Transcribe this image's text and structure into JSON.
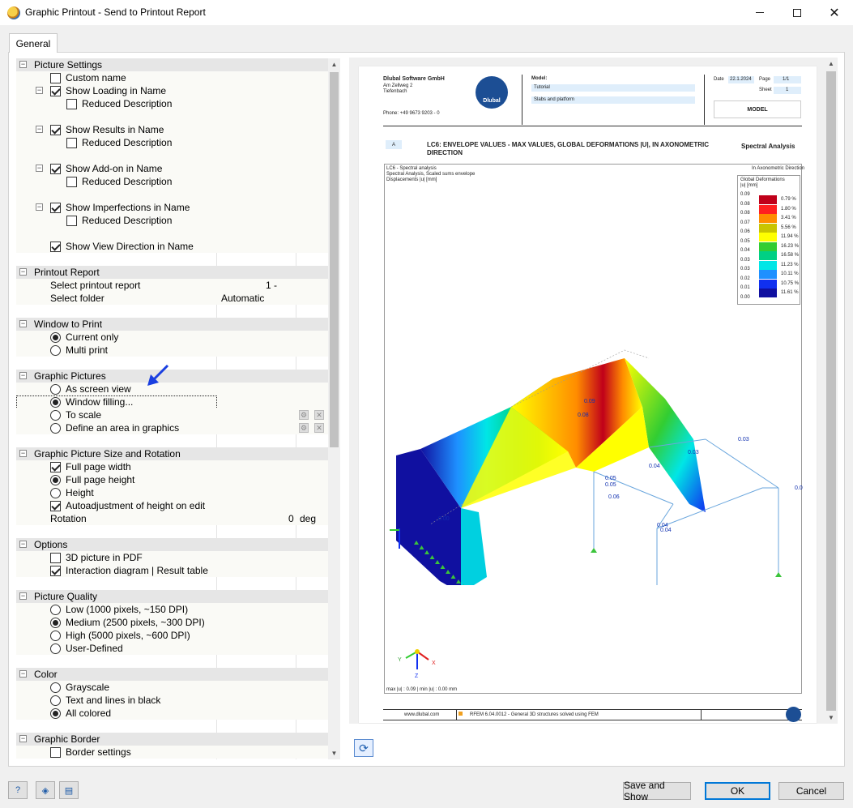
{
  "window": {
    "title": "Graphic Printout - Send to Printout Report",
    "controls": {
      "minimize": "minimize",
      "maximize": "maximize",
      "close": "✕"
    }
  },
  "tabs": [
    {
      "label": "General"
    }
  ],
  "tree": {
    "picture_settings": {
      "title": "Picture Settings",
      "custom_name": "Custom name",
      "show_loading": "Show Loading in Name",
      "reduced_desc_1": "Reduced Description",
      "show_results": "Show Results in Name",
      "reduced_desc_2": "Reduced Description",
      "show_addon": "Show Add-on in Name",
      "reduced_desc_3": "Reduced Description",
      "show_imperfections": "Show Imperfections in Name",
      "reduced_desc_4": "Reduced Description",
      "show_view_direction": "Show View Direction in Name"
    },
    "printout_report": {
      "title": "Printout Report",
      "select_report_label": "Select printout report",
      "select_report_value": "1 -",
      "select_folder_label": "Select folder",
      "select_folder_value": "Automatic"
    },
    "window_to_print": {
      "title": "Window to Print",
      "current_only": "Current only",
      "multi_print": "Multi print"
    },
    "graphic_pictures": {
      "title": "Graphic Pictures",
      "as_screen_view": "As screen view",
      "window_filling": "Window filling...",
      "to_scale": "To scale",
      "define_area": "Define an area in graphics"
    },
    "size_rotation": {
      "title": "Graphic Picture Size and Rotation",
      "full_page_width": "Full page width",
      "full_page_height": "Full page height",
      "height": "Height",
      "autoadjust": "Autoadjustment of height on edit",
      "rotation_label": "Rotation",
      "rotation_value": "0",
      "rotation_unit": "deg"
    },
    "options": {
      "title": "Options",
      "pdf_3d": "3D picture in PDF",
      "interaction": "Interaction diagram | Result table"
    },
    "picture_quality": {
      "title": "Picture Quality",
      "low": "Low (1000 pixels, ~150 DPI)",
      "medium": "Medium (2500 pixels, ~300 DPI)",
      "high": "High (5000 pixels, ~600 DPI)",
      "user_defined": "User-Defined"
    },
    "color": {
      "title": "Color",
      "grayscale": "Grayscale",
      "text_black": "Text and lines in black",
      "all_colored": "All colored"
    },
    "graphic_border": {
      "title": "Graphic Border",
      "border_settings": "Border settings"
    }
  },
  "preview": {
    "company": "Dlubal Software GmbH",
    "address1": "Am Zellweg 2",
    "address2": "Tiefenbach",
    "phone": "Phone: +49 9673 9203 - 0",
    "logo_text": "Dlubal",
    "model_label": "Model:",
    "model_value": "Tutorial",
    "model_desc": "Slabs and platform",
    "date_label": "Date",
    "date_value": "22.1.2024",
    "page_label": "Page",
    "page_value": "1/1",
    "sheet_label": "Sheet",
    "sheet_value": "1",
    "model_box": "MODEL",
    "section_letter": "A",
    "section_title": "LC6: ENVELOPE VALUES - MAX VALUES, GLOBAL DEFORMATIONS |U|, IN AXONOMETRIC DIRECTION",
    "section_right": "Spectral Analysis",
    "info1": "LC6 - Spectral analysis",
    "info2": "Spectral Analysis, Scaled sums envelope",
    "info3": "Displacements |u| [mm]",
    "info_right": "In Axonometric Direction",
    "legend_title1": "Global Deformations",
    "legend_title2": "|u| [mm]",
    "legend_values": [
      "0.09",
      "0.08",
      "0.08",
      "0.07",
      "0.06",
      "0.05",
      "0.04",
      "0.03",
      "0.03",
      "0.02",
      "0.01",
      "0.00"
    ],
    "legend_percents": [
      "0.79 %",
      "1.80 %",
      "3.41 %",
      "5.56 %",
      "11.94 %",
      "16.23 %",
      "16.58 %",
      "11.23 %",
      "10.11 %",
      "10.75 %",
      "11.61 %"
    ],
    "legend_colors": [
      "#c0001a",
      "#ff2020",
      "#ff8c00",
      "#c9c400",
      "#ffff00",
      "#32cd32",
      "#00d084",
      "#00e6e6",
      "#1e90ff",
      "#1030f0",
      "#1010a0"
    ],
    "labels": [
      "0.09",
      "0.08",
      "0.03",
      "0.03",
      "0.04",
      "0.05",
      "0.05",
      "0.06",
      "0.01",
      "0.04",
      "0.04",
      "0.00"
    ],
    "max_min": "max |u| : 0.09 | min |u| : 0.00 mm",
    "footer_web": "www.dlubal.com",
    "footer_sw": "RFEM 6.04.0012 - General 3D structures solved using FEM",
    "axis_y": "Y",
    "axis_x": "X",
    "axis_z": "Z"
  },
  "buttons": {
    "save_show": "Save and Show",
    "ok": "OK",
    "cancel": "Cancel"
  },
  "bottom_icons": [
    "help-icon",
    "model-icon",
    "settings-icon"
  ]
}
